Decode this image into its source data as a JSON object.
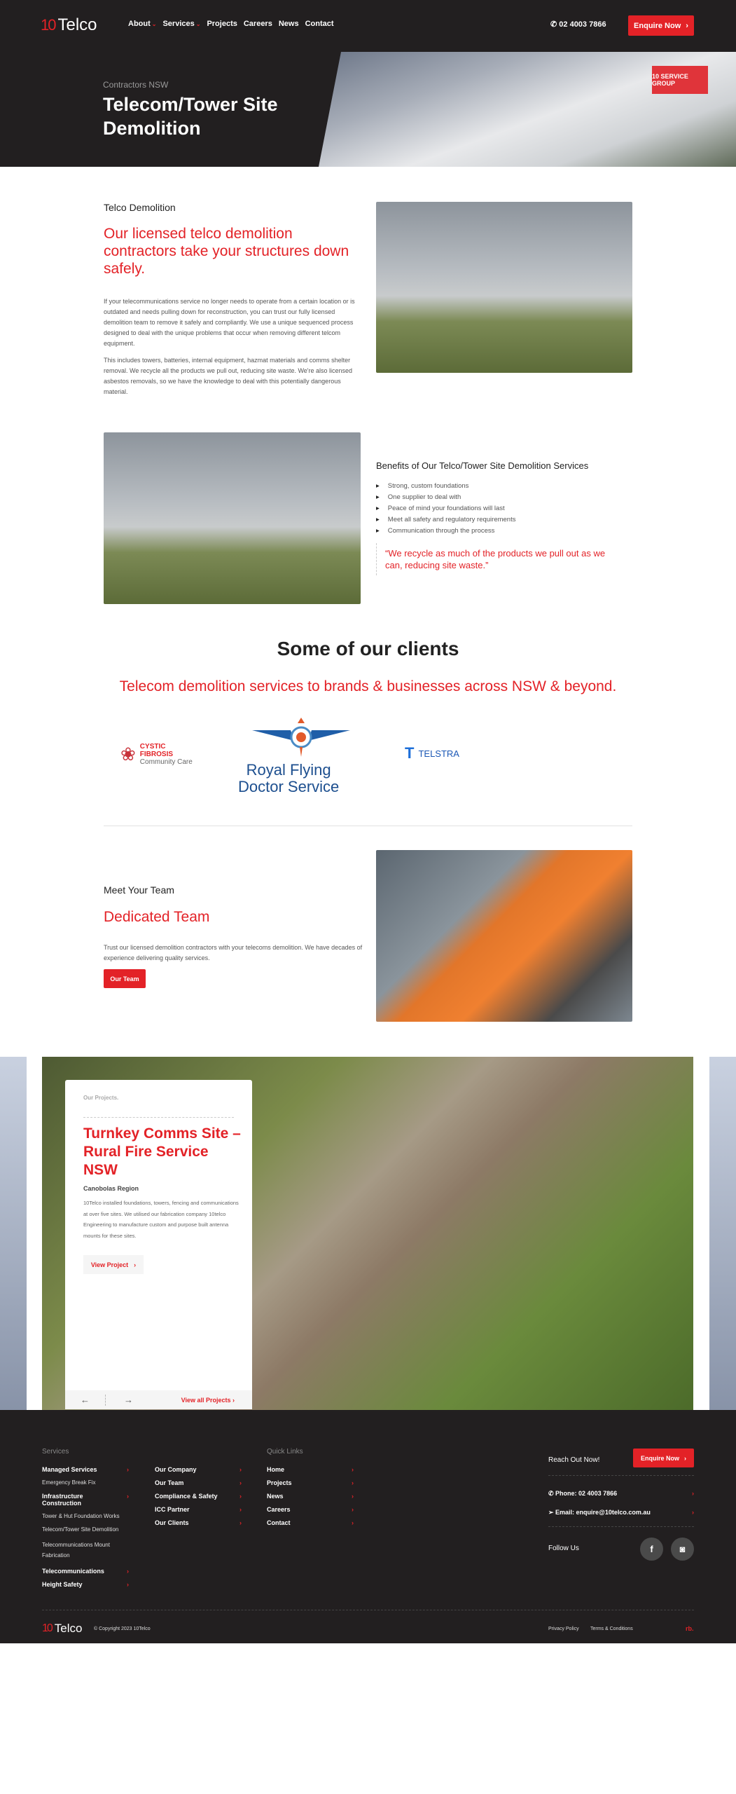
{
  "colors": {
    "accent": "#e32227",
    "dark": "#221f20"
  },
  "header": {
    "logo_mark": "10",
    "logo_text": "Telco",
    "nav": [
      {
        "label": "About",
        "dropdown": true
      },
      {
        "label": "Services",
        "dropdown": true
      },
      {
        "label": "Projects"
      },
      {
        "label": "Careers"
      },
      {
        "label": "News"
      },
      {
        "label": "Contact"
      }
    ],
    "phone": "02 4003 7866",
    "cta": "Enquire Now"
  },
  "hero": {
    "subtitle": "Contractors NSW",
    "title": "Telecom/Tower Site Demolition",
    "image_sign": "10 SERVICE GROUP"
  },
  "intro": {
    "kicker": "Telco Demolition",
    "heading": "Our licensed telco demolition contractors take your structures down safely.",
    "p1": "If your telecommunications service no longer needs to operate from a certain location or is outdated and needs pulling down for reconstruction, you can trust our fully licensed demolition team to remove it safely and compliantly. We use a unique sequenced process designed to deal with the unique problems that occur when removing different telcom equipment.",
    "p2": "This includes towers, batteries, internal equipment, hazmat materials and comms shelter removal. We recycle all the products we pull out, reducing site waste. We're also licensed asbestos removals, so we have the knowledge to deal with this potentially dangerous material."
  },
  "benefits": {
    "heading": "Benefits of Our Telco/Tower Site Demolition Services",
    "items": [
      "Strong, custom foundations",
      "One supplier to deal with",
      "Peace of mind your foundations will last",
      "Meet all safety and regulatory requirements",
      "Communication through the process"
    ],
    "quote": "“We recycle as much of the products we pull out as we can, reducing site waste.”"
  },
  "clients": {
    "heading": "Some of our clients",
    "subheading": "Telecom demolition services to brands & businesses across NSW & beyond.",
    "logos": [
      {
        "l1": "CYSTIC",
        "l2": "FIBROSIS",
        "l3": "Community Care"
      },
      {
        "l1": "Royal Flying",
        "l2": "Doctor Service"
      },
      {
        "l1": "TELSTRA"
      }
    ]
  },
  "team": {
    "kicker": "Meet Your Team",
    "heading": "Dedicated Team",
    "text": "Trust our licensed demolition contractors with your telecoms demolition. We have decades of experience delivering quality services.",
    "button": "Our Team"
  },
  "project": {
    "kicker": "Our Projects.",
    "title": "Turnkey Comms Site – Rural Fire Service NSW",
    "region": "Canobolas Region",
    "text": "10Telco installed foundations, towers, fencing and communications at over five sites. We utilised our fabrication company 10telco Engineering to manufacture custom and purpose built antenna mounts for these sites.",
    "button": "View Project",
    "view_all": "View all Projects"
  },
  "footer": {
    "services_title": "Services",
    "services": [
      {
        "label": "Managed Services",
        "subs": [
          "Emergency Break Fix"
        ]
      },
      {
        "label": "Infrastructure Construction",
        "subs": [
          "Tower & Hut Foundation Works",
          "Telecom/Tower Site Demolition",
          "Telecommunications Mount Fabrication"
        ]
      },
      {
        "label": "Telecommunications",
        "subs": []
      },
      {
        "label": "Height Safety",
        "subs": []
      }
    ],
    "company": [
      "Our Company",
      "Our Team",
      "Compliance & Safety",
      "ICC Partner",
      "Our Clients"
    ],
    "quick_title": "Quick Links",
    "quick": [
      "Home",
      "Projects",
      "News",
      "Careers",
      "Contact"
    ],
    "reach": "Reach Out Now!",
    "cta": "Enquire Now",
    "phone": "Phone: 02 4003 7866",
    "email": "Email: enquire@10telco.com.au",
    "follow": "Follow Us",
    "social": [
      "facebook",
      "instagram"
    ],
    "copyright": "© Copyright 2023 10Telco",
    "privacy": "Privacy Policy",
    "terms": "Terms & Conditions",
    "credit": "rb."
  }
}
